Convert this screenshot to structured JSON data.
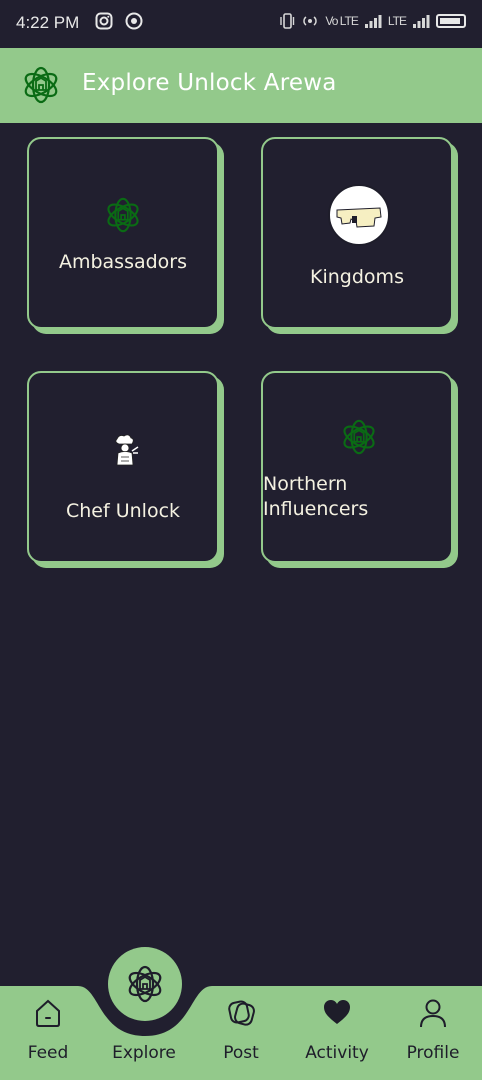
{
  "status_bar": {
    "time": "4:22 PM",
    "left_icons": [
      "instagram-icon",
      "chrome-icon"
    ],
    "right_icons": [
      "vibrate-icon",
      "hotspot-icon",
      "signal-icon",
      "signal-icon",
      "battery-icon"
    ],
    "sig1": "Vo LTE",
    "sig2": "LTE"
  },
  "app_bar": {
    "title": "Explore Unlock Arewa",
    "logo_icon": "arewa-logo-icon"
  },
  "cards": [
    {
      "label": "Ambassadors",
      "icon": "arewa-logo-icon"
    },
    {
      "label": "Kingdoms",
      "icon": "palace-gate-icon"
    },
    {
      "label": "Chef Unlock",
      "icon": "chef-icon"
    },
    {
      "label_line1": "Northern",
      "label_line2": "Influencers",
      "icon": "arewa-logo-icon"
    }
  ],
  "bottom_nav": {
    "items": [
      {
        "label": "Feed",
        "icon": "home-icon"
      },
      {
        "label": "Explore",
        "icon": "arewa-logo-icon",
        "active": true
      },
      {
        "label": "Post",
        "icon": "post-icon"
      },
      {
        "label": "Activity",
        "icon": "heart-icon"
      },
      {
        "label": "Profile",
        "icon": "person-icon"
      }
    ]
  },
  "colors": {
    "background": "#211f2f",
    "accent": "#93c98b",
    "text": "#f4f1e1",
    "logo_green": "#0a6b14"
  }
}
